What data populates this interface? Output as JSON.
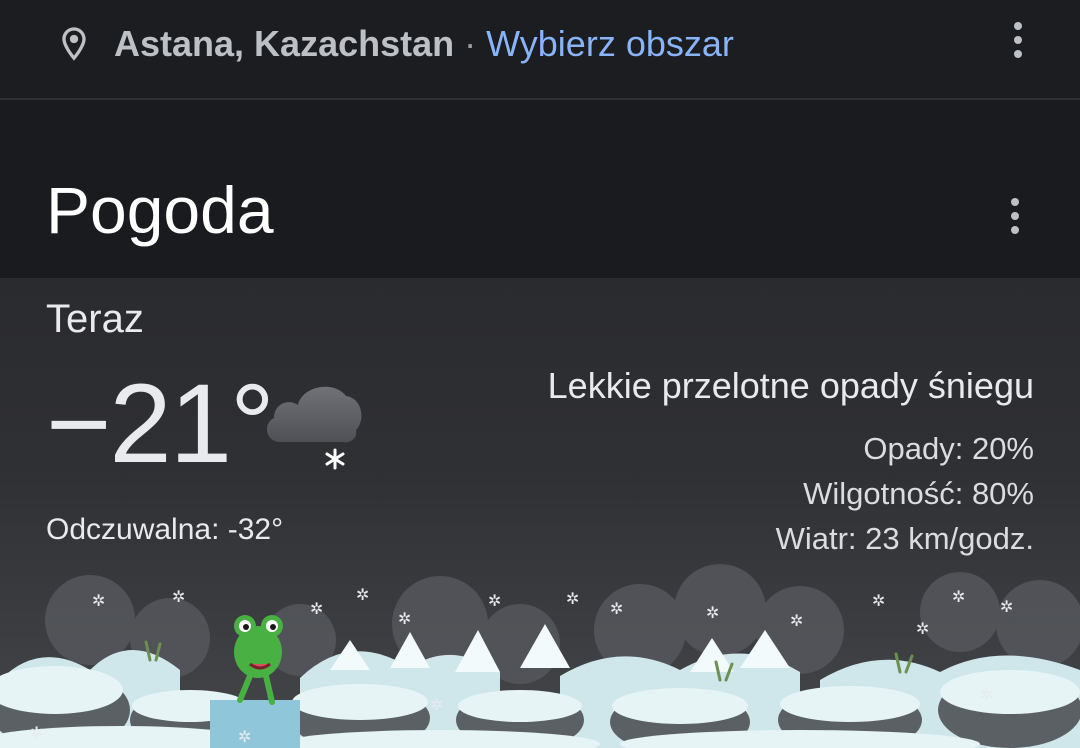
{
  "location": {
    "name": "Astana, Kazachstan",
    "separator": "·",
    "change_link": "Wybierz obszar"
  },
  "card": {
    "title": "Pogoda"
  },
  "now": {
    "label": "Teraz",
    "temperature": "−21°",
    "feels_like": "Odczuwalna: -32°",
    "condition": "Lekkie przelotne opady śniegu",
    "precipitation": "Opady: 20%",
    "humidity": "Wilgotność: 80%",
    "wind": "Wiatr: 23 km/godz."
  },
  "icons": {
    "location": "location-pin-icon",
    "menu": "more-vert-icon",
    "weather": "cloud-snow-icon",
    "scene": "snowy-landscape-frog-illustration"
  },
  "colors": {
    "background": "#1c1d21",
    "link": "#8ab4f8",
    "text": "#e8eaed"
  }
}
